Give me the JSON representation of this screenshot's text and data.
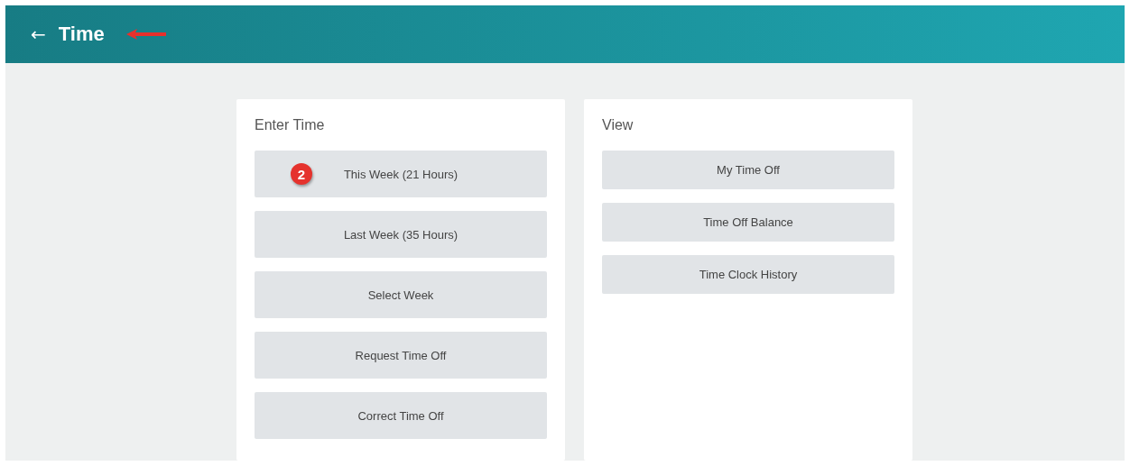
{
  "header": {
    "back_icon": "←",
    "title": "Time"
  },
  "panels": [
    {
      "title": "Enter Time",
      "kind": "tall",
      "buttons": [
        {
          "label": "This Week (21 Hours)",
          "badge": "2"
        },
        {
          "label": "Last Week (35 Hours)"
        },
        {
          "label": "Select Week"
        },
        {
          "label": "Request Time Off"
        },
        {
          "label": "Correct Time Off"
        }
      ]
    },
    {
      "title": "View",
      "kind": "short",
      "buttons": [
        {
          "label": "My Time Off"
        },
        {
          "label": "Time Off Balance"
        },
        {
          "label": "Time Clock History"
        }
      ]
    }
  ]
}
